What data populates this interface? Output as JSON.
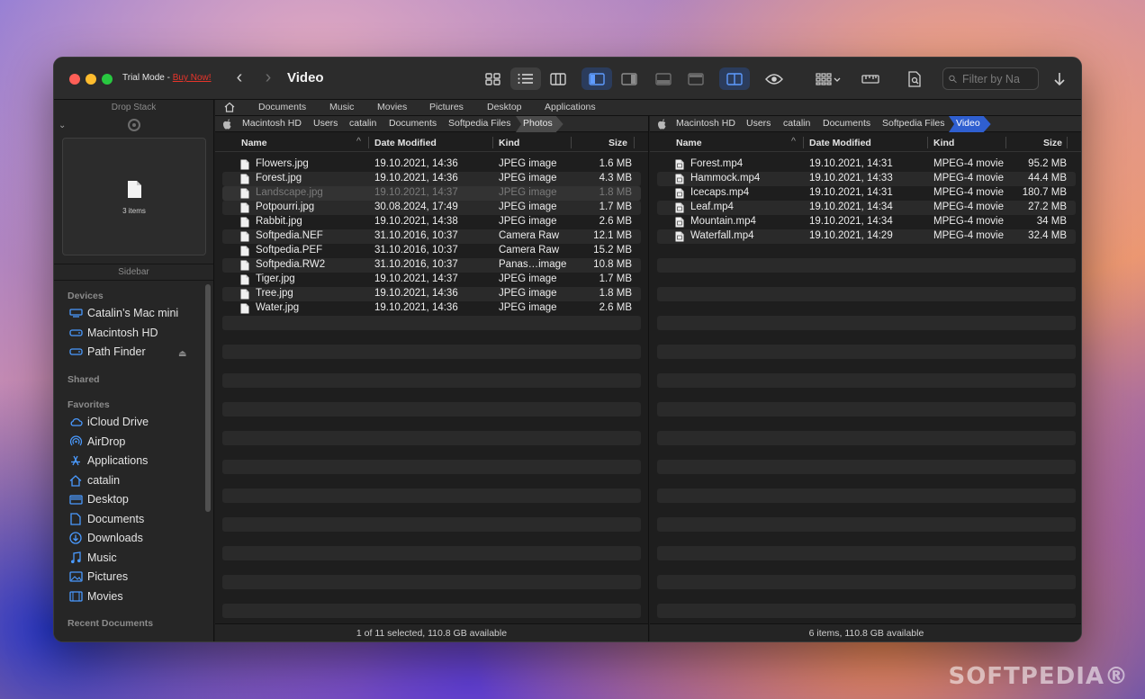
{
  "window": {
    "trial_text": "Trial Mode - ",
    "buy_link": "Buy Now!",
    "title": "Video",
    "filter_placeholder": "Filter by Na"
  },
  "drop_stack": {
    "label": "Drop Stack",
    "count": "3 items"
  },
  "sidebar": {
    "label": "Sidebar",
    "sections": {
      "devices": "Devices",
      "shared": "Shared",
      "favorites": "Favorites",
      "recent": "Recent Documents"
    },
    "devices": [
      {
        "label": "Catalin’s Mac mini",
        "icon": "display-icon"
      },
      {
        "label": "Macintosh HD",
        "icon": "drive-icon"
      },
      {
        "label": "Path Finder",
        "icon": "drive-icon"
      }
    ],
    "favorites": [
      {
        "label": "iCloud Drive",
        "icon": "cloud-icon"
      },
      {
        "label": "AirDrop",
        "icon": "airdrop-icon"
      },
      {
        "label": "Applications",
        "icon": "applications-icon"
      },
      {
        "label": "catalin",
        "icon": "home-icon"
      },
      {
        "label": "Desktop",
        "icon": "desktop-icon"
      },
      {
        "label": "Documents",
        "icon": "document-icon"
      },
      {
        "label": "Downloads",
        "icon": "download-icon"
      },
      {
        "label": "Music",
        "icon": "music-icon"
      },
      {
        "label": "Pictures",
        "icon": "pictures-icon"
      },
      {
        "label": "Movies",
        "icon": "movies-icon"
      }
    ]
  },
  "tabs": [
    "Documents",
    "Music",
    "Movies",
    "Pictures",
    "Desktop",
    "Applications"
  ],
  "left_pane": {
    "breadcrumb": [
      "Macintosh HD",
      "Users",
      "catalin",
      "Documents",
      "Softpedia Files",
      "Photos"
    ],
    "columns": {
      "name": "Name",
      "date": "Date Modified",
      "kind": "Kind",
      "size": "Size"
    },
    "files": [
      {
        "name": "Flowers.jpg",
        "date": "19.10.2021, 14:36",
        "kind": "JPEG image",
        "size": "1.6 MB"
      },
      {
        "name": "Forest.jpg",
        "date": "19.10.2021, 14:36",
        "kind": "JPEG image",
        "size": "4.3 MB"
      },
      {
        "name": "Landscape.jpg",
        "date": "19.10.2021, 14:37",
        "kind": "JPEG image",
        "size": "1.8 MB"
      },
      {
        "name": "Potpourri.jpg",
        "date": "30.08.2024, 17:49",
        "kind": "JPEG image",
        "size": "1.7 MB"
      },
      {
        "name": "Rabbit.jpg",
        "date": "19.10.2021, 14:38",
        "kind": "JPEG image",
        "size": "2.6 MB"
      },
      {
        "name": "Softpedia.NEF",
        "date": "31.10.2016, 10:37",
        "kind": "Camera Raw",
        "size": "12.1 MB"
      },
      {
        "name": "Softpedia.PEF",
        "date": "31.10.2016, 10:37",
        "kind": "Camera Raw",
        "size": "15.2 MB"
      },
      {
        "name": "Softpedia.RW2",
        "date": "31.10.2016, 10:37",
        "kind": "Panas…image",
        "size": "10.8 MB"
      },
      {
        "name": "Tiger.jpg",
        "date": "19.10.2021, 14:37",
        "kind": "JPEG image",
        "size": "1.7 MB"
      },
      {
        "name": "Tree.jpg",
        "date": "19.10.2021, 14:36",
        "kind": "JPEG image",
        "size": "1.8 MB"
      },
      {
        "name": "Water.jpg",
        "date": "19.10.2021, 14:36",
        "kind": "JPEG image",
        "size": "2.6 MB"
      }
    ],
    "status": "1 of 11 selected, 110.8 GB available"
  },
  "right_pane": {
    "breadcrumb": [
      "Macintosh HD",
      "Users",
      "catalin",
      "Documents",
      "Softpedia Files",
      "Video"
    ],
    "columns": {
      "name": "Name",
      "date": "Date Modified",
      "kind": "Kind",
      "size": "Size"
    },
    "files": [
      {
        "name": "Forest.mp4",
        "date": "19.10.2021, 14:31",
        "kind": "MPEG-4 movie",
        "size": "95.2 MB"
      },
      {
        "name": "Hammock.mp4",
        "date": "19.10.2021, 14:33",
        "kind": "MPEG-4 movie",
        "size": "44.4 MB"
      },
      {
        "name": "Icecaps.mp4",
        "date": "19.10.2021, 14:31",
        "kind": "MPEG-4 movie",
        "size": "180.7 MB"
      },
      {
        "name": "Leaf.mp4",
        "date": "19.10.2021, 14:34",
        "kind": "MPEG-4 movie",
        "size": "27.2 MB"
      },
      {
        "name": "Mountain.mp4",
        "date": "19.10.2021, 14:34",
        "kind": "MPEG-4 movie",
        "size": "34 MB"
      },
      {
        "name": "Waterfall.mp4",
        "date": "19.10.2021, 14:29",
        "kind": "MPEG-4 movie",
        "size": "32.4 MB"
      }
    ],
    "status": "6 items, 110.8 GB available"
  },
  "watermark": "SOFTPEDIA®",
  "colors": {
    "accent": "#2f5fd0",
    "sidebar_icon": "#4a9aff",
    "buy_link": "#e8352b"
  }
}
